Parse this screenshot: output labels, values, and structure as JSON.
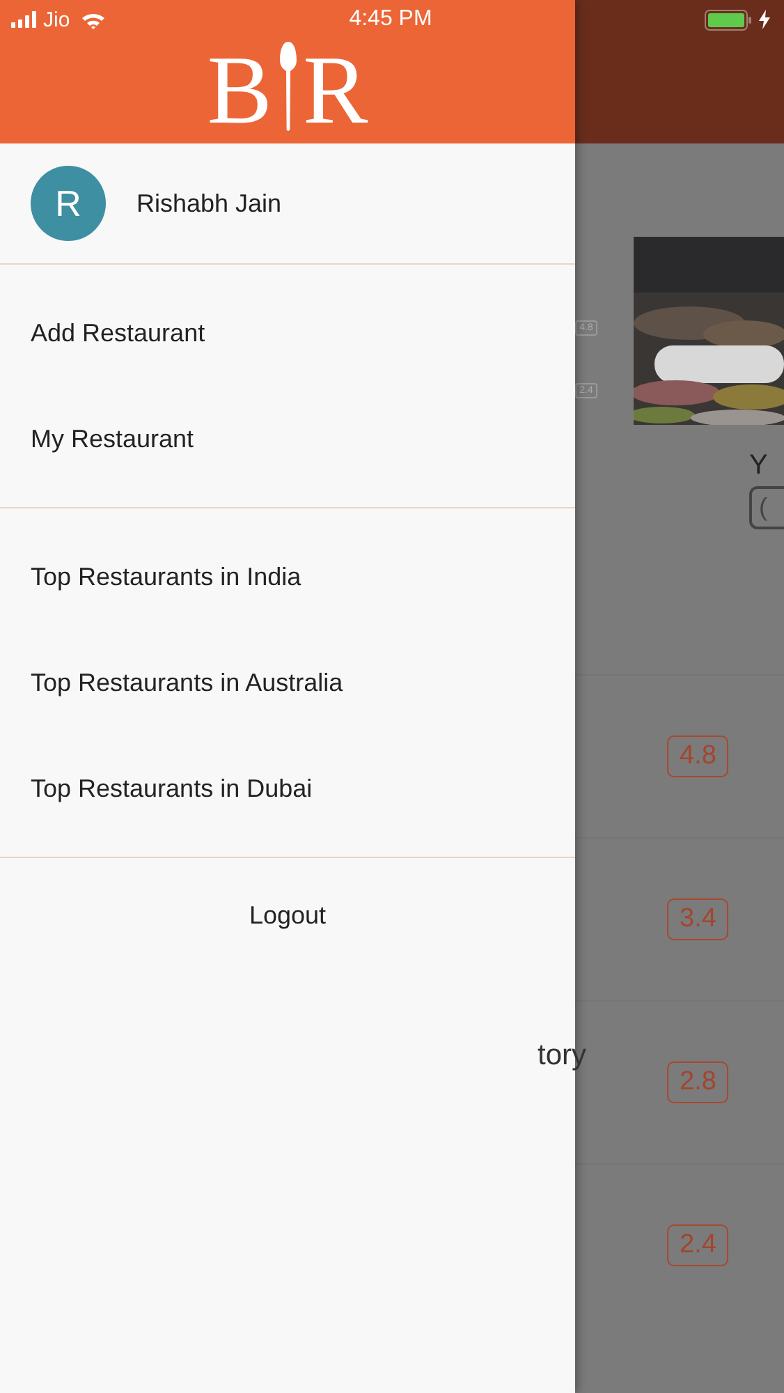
{
  "status_bar": {
    "carrier": "Jio",
    "time": "4:45 PM"
  },
  "logo": {
    "left": "B",
    "right": "R"
  },
  "background": {
    "mini_ratings": [
      "4.8",
      "2.4"
    ],
    "cut_heading": "Y",
    "cut_button": "(",
    "cut_text": "tory",
    "ratings": [
      "4.8",
      "3.4",
      "2.8",
      "2.4"
    ]
  },
  "drawer": {
    "user": {
      "initial": "R",
      "name": "Rishabh Jain"
    },
    "sections": [
      [
        "Add Restaurant",
        "My Restaurant"
      ],
      [
        "Top Restaurants in India",
        "Top Restaurants in Australia",
        "Top Restaurants in Dubai"
      ]
    ],
    "logout": "Logout"
  }
}
